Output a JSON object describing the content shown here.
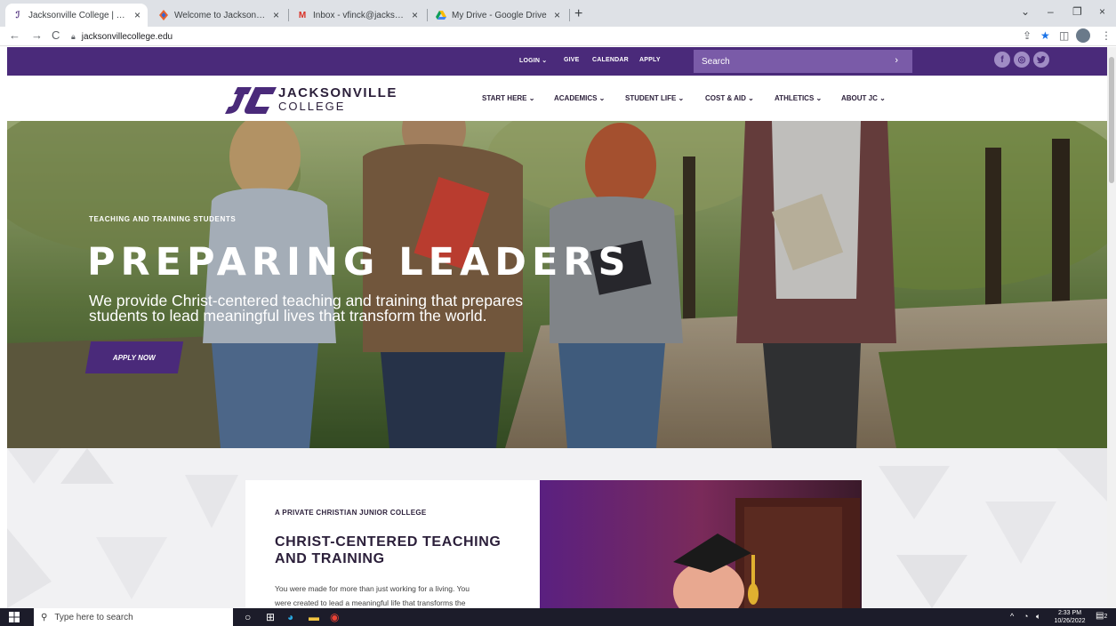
{
  "browser": {
    "tabs": [
      {
        "label": "Jacksonville College | The Oldest",
        "icon": "jc-logo-icon",
        "active": true
      },
      {
        "label": "Welcome to Jacksonville College",
        "icon": "site-icon",
        "active": false
      },
      {
        "label": "Inbox - vfinck@jacksonville-colle",
        "icon": "gmail-icon",
        "active": false
      },
      {
        "label": "My Drive - Google Drive",
        "icon": "drive-icon",
        "active": false
      }
    ],
    "url": "jacksonvillecollege.edu"
  },
  "topbar": {
    "links": [
      "LOGIN ⌄",
      "GIVE",
      "CALENDAR",
      "APPLY"
    ],
    "search_placeholder": "Search",
    "search_arrow": "›",
    "social": [
      "facebook-icon",
      "instagram-icon",
      "twitter-icon"
    ]
  },
  "header": {
    "logo_line1": "JACKSONVILLE",
    "logo_line2": "COLLEGE",
    "nav": [
      "START HERE ⌄",
      "ACADEMICS ⌄",
      "STUDENT LIFE ⌄",
      "COST & AID ⌄",
      "ATHLETICS ⌄",
      "ABOUT JC ⌄"
    ]
  },
  "hero": {
    "eyebrow": "TEACHING AND TRAINING STUDENTS",
    "title": "PREPARING LEADERS",
    "text_line1": "We provide Christ-centered teaching and training that prepares",
    "text_line2": "students to lead meaningful lives that transform the world.",
    "button": "APPLY NOW"
  },
  "intro": {
    "eyebrow": "A PRIVATE CHRISTIAN JUNIOR COLLEGE",
    "title_line1": "CHRIST-CENTERED TEACHING",
    "title_line2": "AND TRAINING",
    "body_line1": "You were made for more than just working for a living. You",
    "body_line2": "were created to lead a meaningful life that transforms the"
  },
  "taskbar": {
    "search_placeholder": "Type here to search",
    "time": "2:33 PM",
    "date": "10/26/2022",
    "notification_count": "2"
  },
  "colors": {
    "brand_purple": "#4a2a7a",
    "search_purple": "#7a5ba8",
    "text_dark": "#2b1f3a"
  }
}
